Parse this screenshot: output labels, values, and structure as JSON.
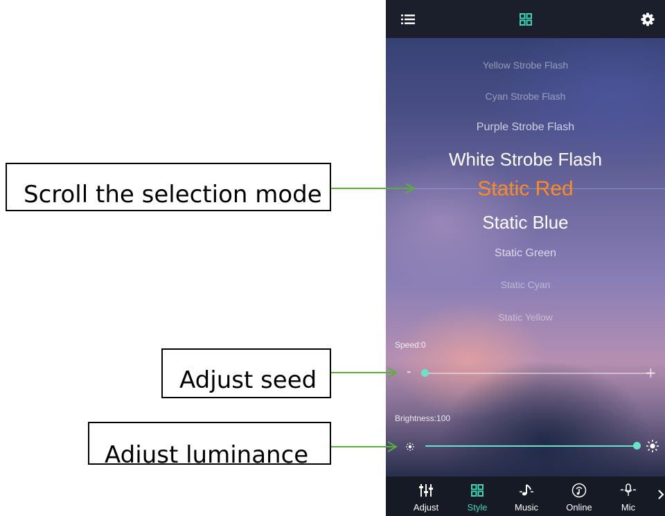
{
  "annotations": {
    "scroll": "Scroll the selection mode",
    "speed": "Adjust seed",
    "brightness": "Adiust luminance"
  },
  "icons": {
    "menu": "list-icon",
    "style": "grid-icon",
    "settings": "gear-icon",
    "brightness_low": "sun-small-icon",
    "brightness_high": "sun-large-icon",
    "more": "chevron-right-icon"
  },
  "modes": [
    "Yellow Strobe Flash",
    "Cyan Strobe Flash",
    "Purple Strobe Flash",
    "White Strobe Flash",
    "Static Red",
    "Static Blue",
    "Static Green",
    "Static Cyan",
    "Static Yellow"
  ],
  "selected_mode": "Static Red",
  "speed": {
    "label": "Speed:0",
    "value": 0,
    "minus": "-",
    "plus": "+"
  },
  "brightness": {
    "label": "Brightness:100",
    "value": 100
  },
  "bottom_nav": [
    {
      "label": "Adjust",
      "icon": "equalizer-icon",
      "active": false
    },
    {
      "label": "Style",
      "icon": "grid-icon",
      "active": true
    },
    {
      "label": "Music",
      "icon": "music-note-icon",
      "active": false
    },
    {
      "label": "Online",
      "icon": "online-music-icon",
      "active": false
    },
    {
      "label": "Mic",
      "icon": "microphone-icon",
      "active": false
    }
  ],
  "colors": {
    "accent": "#3fd6b8",
    "selected": "#ff8a1e",
    "arrow": "#5aaf3c",
    "slider": "#6be3c8"
  }
}
